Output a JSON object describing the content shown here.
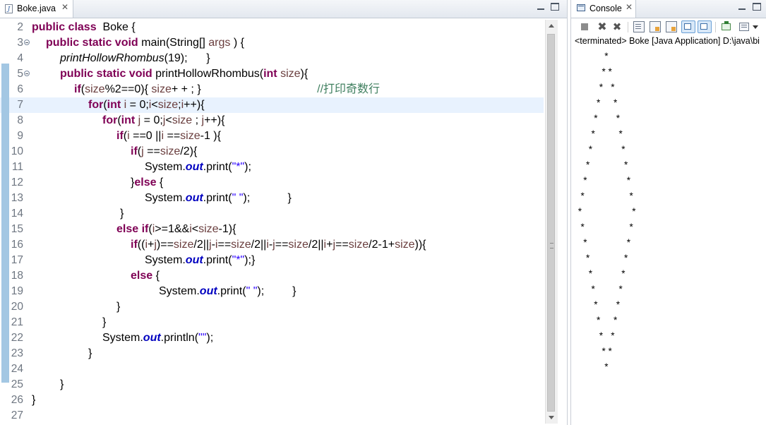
{
  "editor": {
    "tab_label": "Boke.java",
    "current_line": 7,
    "lines": [
      {
        "n": "2",
        "fold": false,
        "ind": 0,
        "segs": [
          [
            "kw",
            "public class"
          ],
          [
            "",
            "  Boke {"
          ]
        ]
      },
      {
        "n": "3",
        "fold": true,
        "ind": 20,
        "segs": [
          [
            "kw",
            "public static void"
          ],
          [
            "",
            " main(String[] "
          ],
          [
            "var",
            "args"
          ],
          [
            "",
            " ) {"
          ]
        ]
      },
      {
        "n": "4",
        "fold": false,
        "ind": 40,
        "segs": [
          [
            "it",
            "printHollowRhombus"
          ],
          [
            "",
            "(19);      }"
          ]
        ]
      },
      {
        "n": "5",
        "fold": true,
        "ind": 40,
        "segs": [
          [
            "kw",
            "public static void"
          ],
          [
            "",
            " printHollowRhombus("
          ],
          [
            "kw",
            "int"
          ],
          [
            "",
            " "
          ],
          [
            "var",
            "size"
          ],
          [
            "",
            "){"
          ]
        ]
      },
      {
        "n": "6",
        "fold": false,
        "ind": 60,
        "segs": [
          [
            "kw",
            "if"
          ],
          [
            "",
            "("
          ],
          [
            "var",
            "size"
          ],
          [
            "",
            "%2==0){ "
          ],
          [
            "var",
            "size"
          ],
          [
            "",
            "+ + ; }                                     "
          ],
          [
            "cm",
            "//打印奇数行"
          ]
        ]
      },
      {
        "n": "7",
        "fold": false,
        "ind": 80,
        "segs": [
          [
            "kw",
            "for"
          ],
          [
            "",
            "("
          ],
          [
            "kw",
            "int"
          ],
          [
            "",
            " "
          ],
          [
            "var",
            "i"
          ],
          [
            "",
            " = 0;"
          ],
          [
            "var",
            "i"
          ],
          [
            "",
            "<"
          ],
          [
            "var",
            "size"
          ],
          [
            "",
            ";"
          ],
          [
            "var",
            "i"
          ],
          [
            "",
            "++){"
          ]
        ]
      },
      {
        "n": "8",
        "fold": false,
        "ind": 100,
        "segs": [
          [
            "kw",
            "for"
          ],
          [
            "",
            "("
          ],
          [
            "kw",
            "int"
          ],
          [
            "",
            " "
          ],
          [
            "var",
            "j"
          ],
          [
            "",
            " = 0;"
          ],
          [
            "var",
            "j"
          ],
          [
            "",
            "<"
          ],
          [
            "var",
            "size"
          ],
          [
            "",
            " ; "
          ],
          [
            "var",
            "j"
          ],
          [
            "",
            "++){"
          ]
        ]
      },
      {
        "n": "9",
        "fold": false,
        "ind": 120,
        "segs": [
          [
            "kw",
            "if"
          ],
          [
            "",
            "("
          ],
          [
            "var",
            "i"
          ],
          [
            "",
            " ==0 ||"
          ],
          [
            "var",
            "i"
          ],
          [
            "",
            " =="
          ],
          [
            "var",
            "size"
          ],
          [
            "",
            "-1 ){"
          ]
        ]
      },
      {
        "n": "10",
        "fold": false,
        "ind": 140,
        "segs": [
          [
            "kw",
            "if"
          ],
          [
            "",
            "("
          ],
          [
            "var",
            "j"
          ],
          [
            "",
            " =="
          ],
          [
            "var",
            "size"
          ],
          [
            "",
            "/2){"
          ]
        ]
      },
      {
        "n": "11",
        "fold": false,
        "ind": 160,
        "segs": [
          [
            "",
            "System."
          ],
          [
            "fld",
            "out"
          ],
          [
            "",
            ".print("
          ],
          [
            "str",
            "\"*\""
          ],
          [
            "",
            ");"
          ]
        ]
      },
      {
        "n": "12",
        "fold": false,
        "ind": 140,
        "segs": [
          [
            "",
            "}"
          ],
          [
            "kw",
            "else"
          ],
          [
            "",
            " {"
          ]
        ]
      },
      {
        "n": "13",
        "fold": false,
        "ind": 160,
        "segs": [
          [
            "",
            "System."
          ],
          [
            "fld",
            "out"
          ],
          [
            "",
            ".print("
          ],
          [
            "str",
            "\" \""
          ],
          [
            "",
            ");            }"
          ]
        ]
      },
      {
        "n": "14",
        "fold": false,
        "ind": 125,
        "segs": [
          [
            "",
            "}"
          ]
        ]
      },
      {
        "n": "15",
        "fold": false,
        "ind": 120,
        "segs": [
          [
            "kw",
            "else if"
          ],
          [
            "",
            "("
          ],
          [
            "var",
            "i"
          ],
          [
            "",
            ">=1&&"
          ],
          [
            "var",
            "i"
          ],
          [
            "",
            "<"
          ],
          [
            "var",
            "size"
          ],
          [
            "",
            "-1){"
          ]
        ]
      },
      {
        "n": "16",
        "fold": false,
        "ind": 140,
        "segs": [
          [
            "kw",
            "if"
          ],
          [
            "",
            "(("
          ],
          [
            "var",
            "i"
          ],
          [
            "",
            "+"
          ],
          [
            "var",
            "j"
          ],
          [
            "",
            ")=="
          ],
          [
            "var",
            "size"
          ],
          [
            "",
            "/2||"
          ],
          [
            "var",
            "j"
          ],
          [
            "",
            "-"
          ],
          [
            "var",
            "i"
          ],
          [
            "",
            "=="
          ],
          [
            "var",
            "size"
          ],
          [
            "",
            "/2||"
          ],
          [
            "var",
            "i"
          ],
          [
            "",
            "-"
          ],
          [
            "var",
            "j"
          ],
          [
            "",
            "=="
          ],
          [
            "var",
            "size"
          ],
          [
            "",
            "/2||"
          ],
          [
            "var",
            "i"
          ],
          [
            "",
            "+"
          ],
          [
            "var",
            "j"
          ],
          [
            "",
            "=="
          ],
          [
            "var",
            "size"
          ],
          [
            "",
            "/2-1+"
          ],
          [
            "var",
            "size"
          ],
          [
            "",
            ")){"
          ]
        ]
      },
      {
        "n": "17",
        "fold": false,
        "ind": 160,
        "segs": [
          [
            "",
            "System."
          ],
          [
            "fld",
            "out"
          ],
          [
            "",
            ".print("
          ],
          [
            "str",
            "\"*\""
          ],
          [
            "",
            ");}"
          ]
        ]
      },
      {
        "n": "18",
        "fold": false,
        "ind": 140,
        "segs": [
          [
            "kw",
            "else"
          ],
          [
            "",
            " {"
          ]
        ]
      },
      {
        "n": "19",
        "fold": false,
        "ind": 180,
        "segs": [
          [
            "",
            "System."
          ],
          [
            "fld",
            "out"
          ],
          [
            "",
            ".print("
          ],
          [
            "str",
            "\" \""
          ],
          [
            "",
            ");         }"
          ]
        ]
      },
      {
        "n": "20",
        "fold": false,
        "ind": 120,
        "segs": [
          [
            "",
            "}"
          ]
        ]
      },
      {
        "n": "21",
        "fold": false,
        "ind": 100,
        "segs": [
          [
            "",
            "}"
          ]
        ]
      },
      {
        "n": "22",
        "fold": false,
        "ind": 100,
        "segs": [
          [
            "",
            "System."
          ],
          [
            "fld",
            "out"
          ],
          [
            "",
            ".println("
          ],
          [
            "str",
            "\"\""
          ],
          [
            "",
            ");"
          ]
        ]
      },
      {
        "n": "23",
        "fold": false,
        "ind": 80,
        "segs": [
          [
            "",
            "}"
          ]
        ]
      },
      {
        "n": "24",
        "fold": false,
        "ind": 0,
        "segs": []
      },
      {
        "n": "25",
        "fold": false,
        "ind": 40,
        "segs": [
          [
            "",
            "}"
          ]
        ]
      },
      {
        "n": "26",
        "fold": false,
        "ind": 0,
        "segs": [
          [
            "",
            "}"
          ]
        ]
      },
      {
        "n": "27",
        "fold": false,
        "ind": 0,
        "segs": []
      }
    ]
  },
  "console": {
    "tab_label": "Console",
    "title": "<terminated> Boke [Java Application] D:\\java\\bi",
    "toolbar_icons": [
      "terminate-icon",
      "remove-launch-icon",
      "remove-all-icon",
      "clear-console-icon",
      "scroll-lock-icon",
      "word-wrap-icon",
      "show-stdout-icon",
      "show-stderr-icon",
      "pin-console-icon",
      "display-console-icon"
    ],
    "output_lines": [
      "           *",
      "          * *",
      "         *   *",
      "        *     *",
      "       *       *",
      "      *         *",
      "     *           *",
      "    *             *",
      "   *               *",
      "  *                 *",
      " *                   *",
      "  *                 *",
      "   *               *",
      "    *             *",
      "     *           *",
      "      *         *",
      "       *       *",
      "        *     *",
      "         *   *",
      "          * *",
      "           *"
    ]
  }
}
